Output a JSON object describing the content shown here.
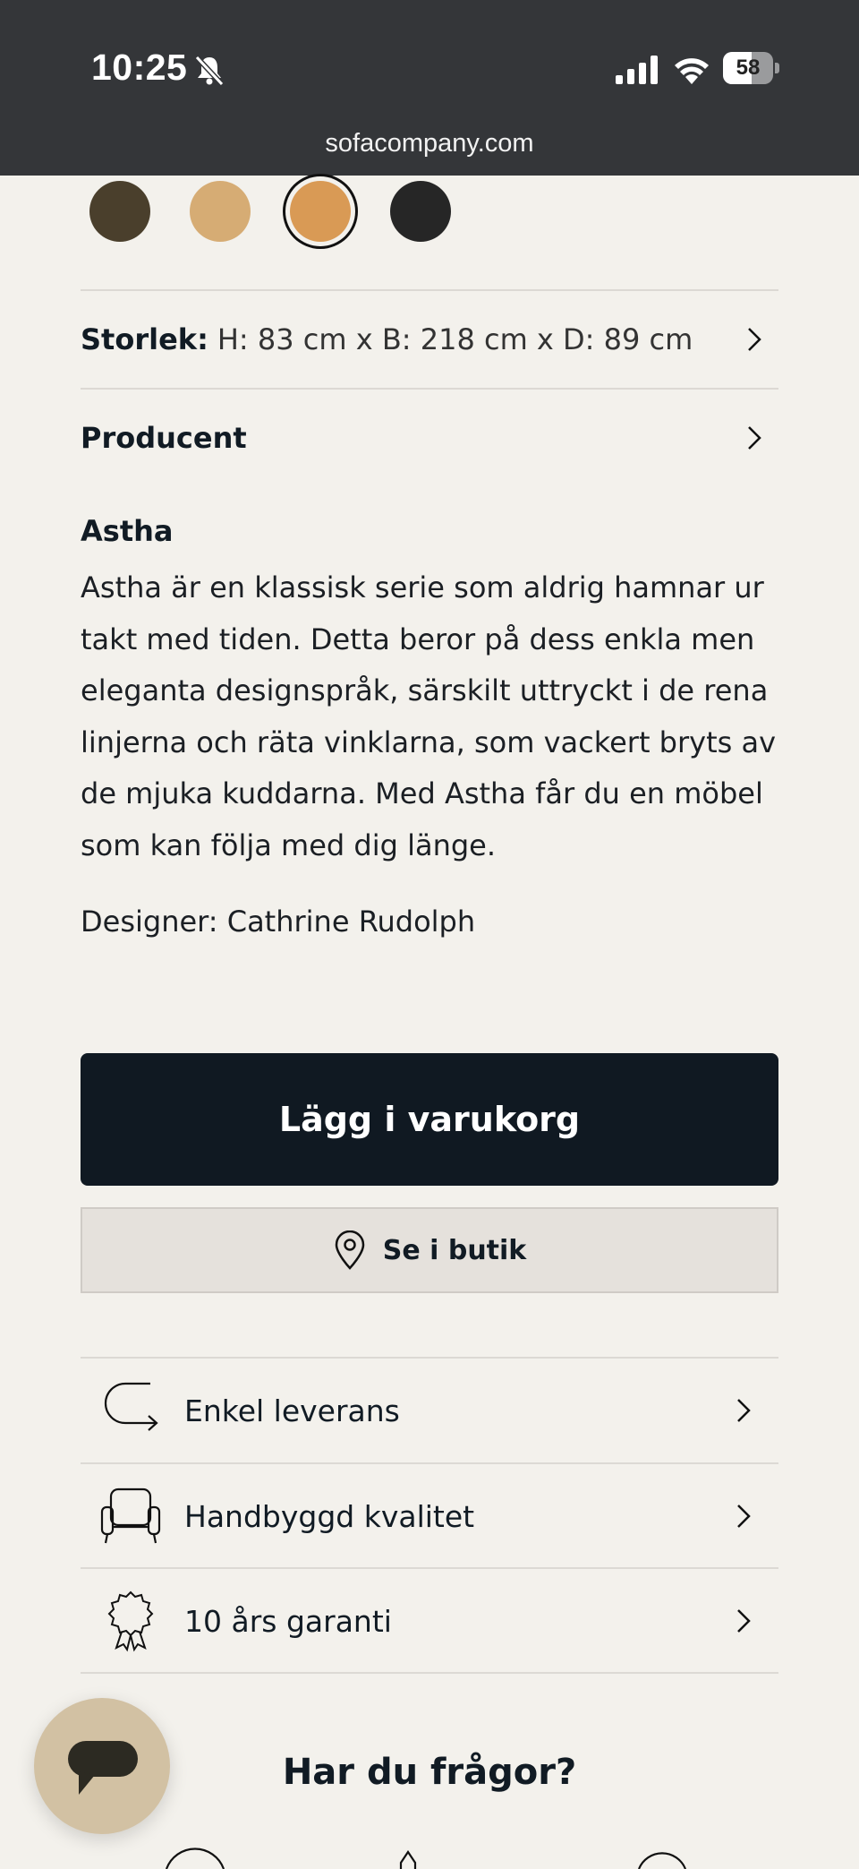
{
  "status_bar": {
    "time": "10:25",
    "battery": "58",
    "battery_level": 0.58,
    "url": "sofacompany.com"
  },
  "swatches": [
    {
      "name": "dark-oak",
      "color": "#4a3f2c"
    },
    {
      "name": "light-oak",
      "color": "#d6ac74"
    },
    {
      "name": "natural-oak",
      "color": "#d99a55",
      "selected": true
    },
    {
      "name": "black",
      "color": "#262626"
    }
  ],
  "specs": {
    "size_label": "Storlek:",
    "size_value": "H: 83 cm x B: 218 cm x D: 89 cm",
    "producer_label": "Producent"
  },
  "description": {
    "title": "Astha",
    "body": "Astha är en klassisk serie som aldrig hamnar ur takt med tiden. Detta beror på dess enkla men eleganta designspråk, särskilt uttryckt i de rena linjerna och räta vinklarna, som vackert bryts av de mjuka kuddarna. Med Astha får du en möbel som kan följa med dig länge.",
    "designer": "Designer: Cathrine Rudolph"
  },
  "actions": {
    "add_to_cart": "Lägg i varukorg",
    "see_in_store": "Se i butik"
  },
  "features": [
    {
      "label": "Enkel leverans",
      "icon": "delivery-arrow-icon"
    },
    {
      "label": "Handbyggd kvalitet",
      "icon": "armchair-icon"
    },
    {
      "label": "10 års garanti",
      "icon": "award-badge-icon"
    }
  ],
  "help": {
    "title": "Har du frågor?"
  }
}
